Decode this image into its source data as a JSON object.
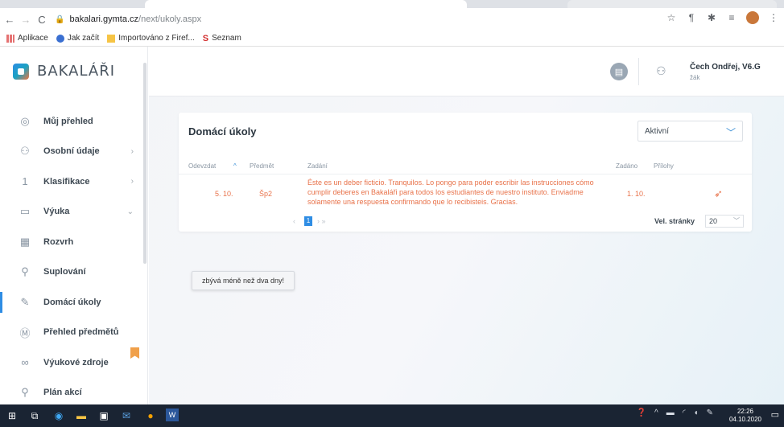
{
  "browser": {
    "url_host": "bakalari.gymta.cz",
    "url_path": "/next/ukoly.aspx",
    "bookmarks": [
      {
        "label": "Aplikace",
        "icon": "apps-icon"
      },
      {
        "label": "Jak začít",
        "icon": "firefox-icon"
      },
      {
        "label": "Importováno z Firef...",
        "icon": "folder-icon"
      },
      {
        "label": "Seznam",
        "icon": "seznam-icon"
      }
    ]
  },
  "logo": {
    "text": "BAKALÁŘI"
  },
  "sidebar": {
    "items": [
      {
        "label": "Můj přehled",
        "icon": "dashboard-icon"
      },
      {
        "label": "Osobní údaje",
        "icon": "person-card-icon"
      },
      {
        "label": "Klasifikace",
        "icon": "grade-icon"
      },
      {
        "label": "Výuka",
        "icon": "teaching-icon"
      },
      {
        "label": "Rozvrh",
        "icon": "schedule-icon"
      },
      {
        "label": "Suplování",
        "icon": "substitution-icon"
      },
      {
        "label": "Domácí úkoly",
        "icon": "homework-icon"
      },
      {
        "label": "Přehled předmětů",
        "icon": "subjects-icon"
      },
      {
        "label": "Výukové zdroje",
        "icon": "resources-icon"
      },
      {
        "label": "Plán akcí",
        "icon": "events-icon"
      }
    ]
  },
  "user": {
    "name": "Čech Ondřej, V6.G",
    "role": "žák"
  },
  "homework": {
    "title": "Domácí úkoly",
    "filter_value": "Aktivní",
    "columns": {
      "due": "Odevzdat",
      "subject": "Předmět",
      "task": "Zadání",
      "assigned": "Zadáno",
      "attachments": "Přílohy"
    },
    "rows": [
      {
        "due": "5. 10.",
        "subject": "Šp2",
        "task": "Éste es un deber ficticio. Tranquilos. Lo pongo para poder escribir las instrucciones cómo cumplir deberes en Bakaláři para todos los estudiantes de nuestro instituto. Enviadme solamente una respuesta confirmando que lo recibisteis. Gracias.",
        "assigned": "1. 10."
      }
    ],
    "page": "1",
    "page_size_label": "Vel. stránky",
    "page_size": "20",
    "tooltip": "zbývá méně než dva dny!"
  },
  "taskbar": {
    "time": "22:26",
    "date": "04.10.2020"
  }
}
